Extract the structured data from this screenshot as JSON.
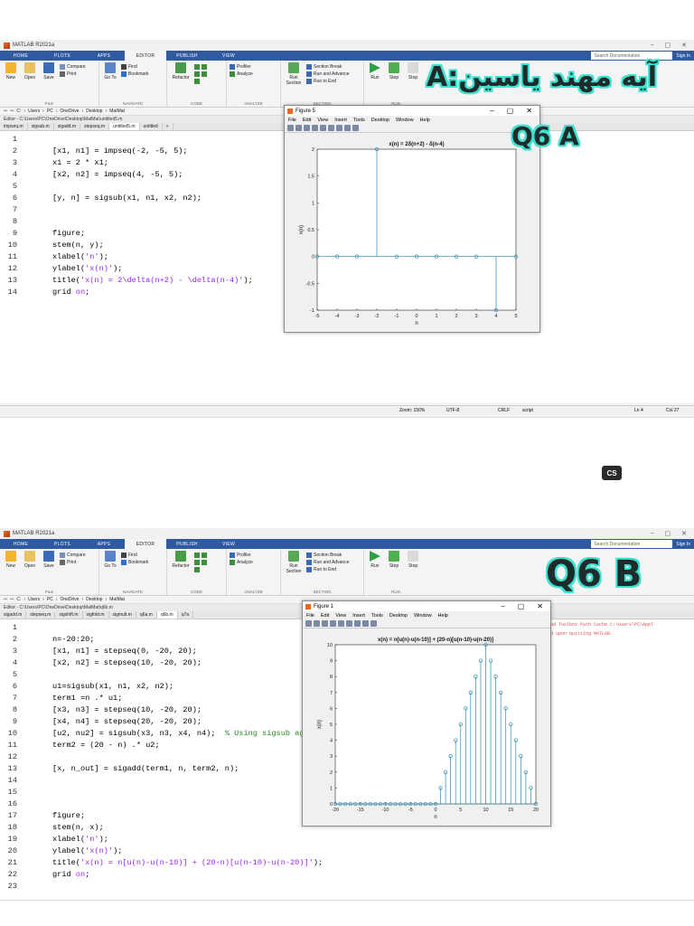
{
  "app_title": "MATLAB R2021a",
  "top_tabs": [
    "HOME",
    "PLOTS",
    "APPS",
    "EDITOR",
    "PUBLISH",
    "VIEW"
  ],
  "search_placeholder": "Search Documentation",
  "sign_in": "Sign In",
  "ribbon": {
    "file": {
      "group": "FILE",
      "new": "New",
      "open": "Open",
      "save": "Save",
      "compare": "Compare",
      "print": "Print"
    },
    "navigate": {
      "group": "NAVIGATE",
      "goto": "Go To",
      "find": "Find",
      "bookmark": "Bookmark"
    },
    "code": {
      "group": "CODE",
      "refactor": "Refactor"
    },
    "analyze": {
      "group": "ANALYZE",
      "profiler": "Profiler",
      "analyze": "Analyze"
    },
    "section": {
      "group": "SECTION",
      "run_section": "Run Section",
      "section_break": "Section Break",
      "run_advance": "Run and Advance",
      "run_to_end": "Run to End"
    },
    "run": {
      "group": "RUN",
      "run": "Run",
      "step": "Step",
      "stop": "Stop"
    }
  },
  "top": {
    "breadcrumb": [
      "C:",
      "Users",
      "PC",
      "OneDrive",
      "Desktop",
      "MatMat"
    ],
    "editor_path": "Editor - C:\\Users\\PC\\OneDrive\\Desktop\\MatMat\\untitled5.m",
    "file_tabs": [
      "impseq.m",
      "sigsub.m",
      "sigadd.m",
      "stepseq.m",
      "untitled5.m",
      "untitled"
    ],
    "active_tab": "untitled5.m",
    "lines": [
      {
        "n": "1",
        "parts": []
      },
      {
        "n": "2",
        "parts": [
          {
            "t": "[x1, n1] = impseq(-2, -5, 5);",
            "c": ""
          }
        ]
      },
      {
        "n": "3",
        "parts": [
          {
            "t": "x1 = 2 * x1;",
            "c": ""
          }
        ]
      },
      {
        "n": "4",
        "parts": [
          {
            "t": "[x2, n2] = impseq(4, -5, 5);",
            "c": ""
          }
        ]
      },
      {
        "n": "5",
        "parts": []
      },
      {
        "n": "6",
        "parts": [
          {
            "t": "[y, n] = sigsub(x1, n1, x2, n2);",
            "c": ""
          }
        ]
      },
      {
        "n": "7",
        "parts": []
      },
      {
        "n": "8",
        "parts": []
      },
      {
        "n": "9",
        "parts": [
          {
            "t": "figure;",
            "c": ""
          }
        ]
      },
      {
        "n": "10",
        "parts": [
          {
            "t": "stem(n, y);",
            "c": ""
          }
        ]
      },
      {
        "n": "11",
        "parts": [
          {
            "t": "xlabel(",
            "c": ""
          },
          {
            "t": "'n'",
            "c": "str"
          },
          {
            "t": ");",
            "c": ""
          }
        ]
      },
      {
        "n": "12",
        "parts": [
          {
            "t": "ylabel(",
            "c": ""
          },
          {
            "t": "'x(n)'",
            "c": "str"
          },
          {
            "t": ");",
            "c": ""
          }
        ]
      },
      {
        "n": "13",
        "parts": [
          {
            "t": "title(",
            "c": ""
          },
          {
            "t": "'x(n) = 2\\delta(n+2) - \\delta(n-4)'",
            "c": "str"
          },
          {
            "t": ");",
            "c": ""
          }
        ]
      },
      {
        "n": "14",
        "parts": [
          {
            "t": "grid ",
            "c": ""
          },
          {
            "t": "on",
            "c": "str"
          },
          {
            "t": ";",
            "c": ""
          }
        ]
      }
    ],
    "status": {
      "zoom": "Zoom: 150%",
      "encoding": "UTF-8",
      "eol": "CRLF",
      "type": "script",
      "ln": "Ln  4",
      "col": "Col  27"
    },
    "figure": {
      "title": "Figure 5",
      "menu": [
        "File",
        "Edit",
        "View",
        "Insert",
        "Tools",
        "Desktop",
        "Window",
        "Help"
      ]
    },
    "handwritten_1": "آیه مهند یاسین:A",
    "handwritten_2": "Q6 A"
  },
  "bottom": {
    "breadcrumb": [
      "C:",
      "Users",
      "PC",
      "OneDrive",
      "Desktop",
      "MatMat"
    ],
    "editor_path": "Editor - C:\\Users\\PC\\OneDrive\\Desktop\\MatMat\\q6b.m",
    "file_tabs": [
      "sigadd.m",
      "stepseq.m",
      "sigshift.m",
      "sigfold.m",
      "sigmult.m",
      "q6a.m",
      "q6b.m",
      "q7a"
    ],
    "active_tab": "q6b.m",
    "lines": [
      {
        "n": "1",
        "parts": []
      },
      {
        "n": "2",
        "parts": [
          {
            "t": "n=-20:20;",
            "c": ""
          }
        ]
      },
      {
        "n": "3",
        "parts": [
          {
            "t": "[x1, n1] = stepseq(0, -20, 20);",
            "c": ""
          }
        ]
      },
      {
        "n": "4",
        "parts": [
          {
            "t": "[x2, n2] = stepseq(10, -20, 20);",
            "c": ""
          }
        ]
      },
      {
        "n": "5",
        "parts": []
      },
      {
        "n": "6",
        "parts": [
          {
            "t": "u1=sigsub(x1, n1, x2, n2);",
            "c": ""
          }
        ]
      },
      {
        "n": "7",
        "parts": [
          {
            "t": "term1 =n .* u1;",
            "c": ""
          }
        ]
      },
      {
        "n": "8",
        "parts": [
          {
            "t": "[x3, n3] = stepseq(10, -20, 20);",
            "c": ""
          }
        ]
      },
      {
        "n": "9",
        "parts": [
          {
            "t": "[x4, n4] = stepseq(20, -20, 20);",
            "c": ""
          }
        ]
      },
      {
        "n": "10",
        "parts": [
          {
            "t": "[u2, nu2] = sigsub(x3, n3, x4, n4);  ",
            "c": ""
          },
          {
            "t": "% Using sigsub again",
            "c": "cmt"
          }
        ]
      },
      {
        "n": "11",
        "parts": [
          {
            "t": "term2 = (20 - n) .* u2;",
            "c": ""
          }
        ]
      },
      {
        "n": "12",
        "parts": []
      },
      {
        "n": "13",
        "parts": [
          {
            "t": "[x, n_out] = sigadd(term1, n, term2, n);",
            "c": ""
          }
        ]
      },
      {
        "n": "14",
        "parts": []
      },
      {
        "n": "15",
        "parts": []
      },
      {
        "n": "16",
        "parts": []
      },
      {
        "n": "17",
        "parts": [
          {
            "t": "figure;",
            "c": ""
          }
        ]
      },
      {
        "n": "18",
        "parts": [
          {
            "t": "stem(n, x);",
            "c": ""
          }
        ]
      },
      {
        "n": "19",
        "parts": [
          {
            "t": "xlabel(",
            "c": ""
          },
          {
            "t": "'n'",
            "c": "str"
          },
          {
            "t": ");",
            "c": ""
          }
        ]
      },
      {
        "n": "20",
        "parts": [
          {
            "t": "ylabel(",
            "c": ""
          },
          {
            "t": "'x(n)'",
            "c": "str"
          },
          {
            "t": ");",
            "c": ""
          }
        ]
      },
      {
        "n": "21",
        "parts": [
          {
            "t": "title(",
            "c": ""
          },
          {
            "t": "'x(n) = n[u(n)-u(n-10)] + (20-n)[u(n-10)-u(n-20)]'",
            "c": "str"
          },
          {
            "t": ");",
            "c": ""
          }
        ]
      },
      {
        "n": "22",
        "parts": [
          {
            "t": "grid ",
            "c": ""
          },
          {
            "t": "on",
            "c": "str"
          },
          {
            "t": ";",
            "c": ""
          }
        ]
      },
      {
        "n": "23",
        "parts": []
      }
    ],
    "cmd_1": "oad Toolbox Path Cache C:\\Users\\PC\\Appl",
    "cmd_2": "ed upon quitting MATLAB.",
    "figure": {
      "title": "Figure 1",
      "menu": [
        "File",
        "Edit",
        "View",
        "Insert",
        "Tools",
        "Desktop",
        "Window",
        "Help"
      ]
    },
    "handwritten": "Q6 B"
  },
  "cs_badge": "CS",
  "chart_data": [
    {
      "type": "stem",
      "title": "x(n) = 2δ(n+2) - δ(n-4)",
      "xlabel": "n",
      "ylabel": "x(n)",
      "x": [
        -5,
        -4,
        -3,
        -2,
        -1,
        0,
        1,
        2,
        3,
        4,
        5
      ],
      "y": [
        0,
        0,
        0,
        2,
        0,
        0,
        0,
        0,
        0,
        -1,
        0
      ],
      "xlim": [
        -5,
        5
      ],
      "ylim": [
        -1,
        2
      ],
      "xticks": [
        -5,
        -4,
        -3,
        -2,
        -1,
        0,
        1,
        2,
        3,
        4,
        5
      ],
      "yticks": [
        -1,
        -0.5,
        0,
        0.5,
        1,
        1.5,
        2
      ],
      "grid": "off",
      "color": "#2e8bb0"
    },
    {
      "type": "stem",
      "title": "x(n) = n[u(n)-u(n-10)] + (20-n)[u(n-10)-u(n-20)]",
      "xlabel": "n",
      "ylabel": "x(n)",
      "x": [
        -20,
        -19,
        -18,
        -17,
        -16,
        -15,
        -14,
        -13,
        -12,
        -11,
        -10,
        -9,
        -8,
        -7,
        -6,
        -5,
        -4,
        -3,
        -2,
        -1,
        0,
        1,
        2,
        3,
        4,
        5,
        6,
        7,
        8,
        9,
        10,
        11,
        12,
        13,
        14,
        15,
        16,
        17,
        18,
        19,
        20
      ],
      "y": [
        0,
        0,
        0,
        0,
        0,
        0,
        0,
        0,
        0,
        0,
        0,
        0,
        0,
        0,
        0,
        0,
        0,
        0,
        0,
        0,
        0,
        1,
        2,
        3,
        4,
        5,
        6,
        7,
        8,
        9,
        10,
        9,
        8,
        7,
        6,
        5,
        4,
        3,
        2,
        1,
        0
      ],
      "xlim": [
        -20,
        20
      ],
      "ylim": [
        0,
        10
      ],
      "xticks": [
        -20,
        -15,
        -10,
        -5,
        0,
        5,
        10,
        15,
        20
      ],
      "yticks": [
        0,
        1,
        2,
        3,
        4,
        5,
        6,
        7,
        8,
        9,
        10
      ],
      "grid": "off",
      "color": "#2e8bb0"
    }
  ]
}
